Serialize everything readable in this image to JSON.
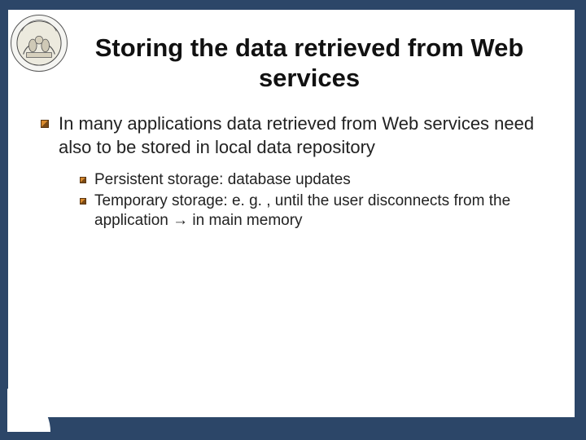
{
  "title": "Storing the data retrieved from Web services",
  "bullet1": "In many applications data retrieved from Web services need also to be stored in local data repository",
  "sub1": "Persistent storage: database updates",
  "sub2": "Temporary storage: e. g. , until the user disconnects from the application → in main memory",
  "logo_alt": "Politecnico di Milano seal"
}
